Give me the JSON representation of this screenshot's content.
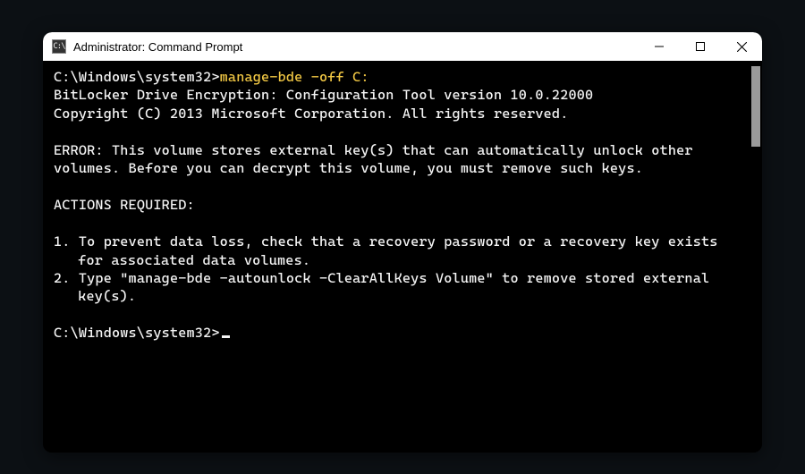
{
  "window": {
    "title": "Administrator: Command Prompt",
    "icon_text": "C:\\"
  },
  "terminal": {
    "prompt": "C:\\Windows\\system32>",
    "command": "manage-bde -off C:",
    "out_line1": "BitLocker Drive Encryption: Configuration Tool version 10.0.22000",
    "out_line2": "Copyright (C) 2013 Microsoft Corporation. All rights reserved.",
    "err_line1": "ERROR: This volume stores external key(s) that can automatically unlock other volumes. Before you can decrypt this volume, you must remove such keys.",
    "actions_header": "ACTIONS REQUIRED:",
    "action1": "1. To prevent data loss, check that a recovery password or a recovery key exists for associated data volumes.",
    "action2": "2. Type \"manage-bde -autounlock -ClearAllKeys Volume\" to remove stored external key(s).",
    "prompt2": "C:\\Windows\\system32>"
  }
}
